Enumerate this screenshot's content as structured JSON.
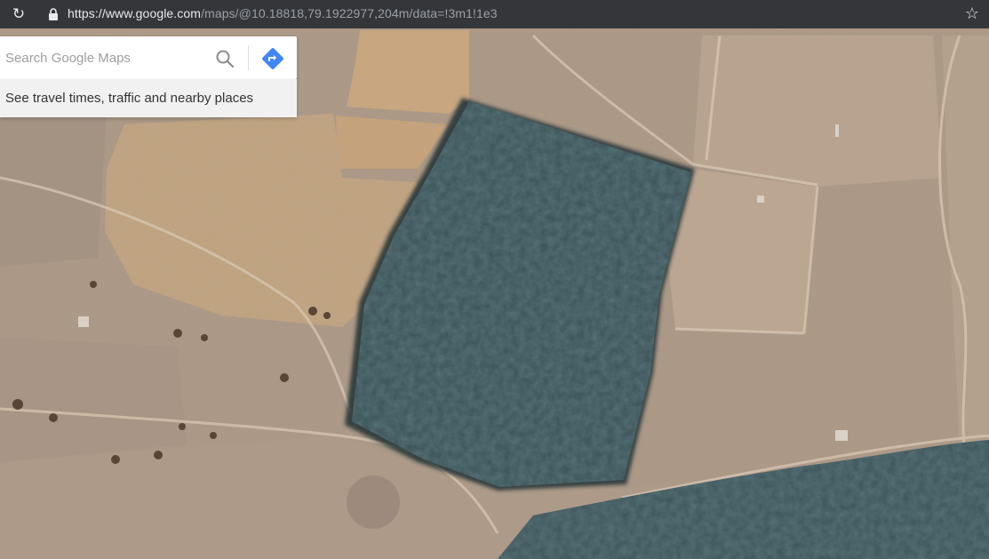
{
  "browser": {
    "url_host": "https://www.google.com",
    "url_path": "/maps/@10.18818,79.1922977,204m/data=!3m1!1e3",
    "reload_icon": "reload-icon",
    "lock_icon": "lock-icon",
    "bookmark_icon": "star-icon"
  },
  "search": {
    "placeholder": "Search Google Maps",
    "search_icon": "search-icon",
    "directions_icon": "directions-icon",
    "accent": "#4285f4"
  },
  "hint": {
    "text": "See travel times, traffic and nearby places"
  },
  "map": {
    "view": "satellite",
    "colors": {
      "field_light": "#c9ab86",
      "field_dark": "#a89787",
      "forest": "#2f4548",
      "track": "#d4c2ad"
    }
  }
}
